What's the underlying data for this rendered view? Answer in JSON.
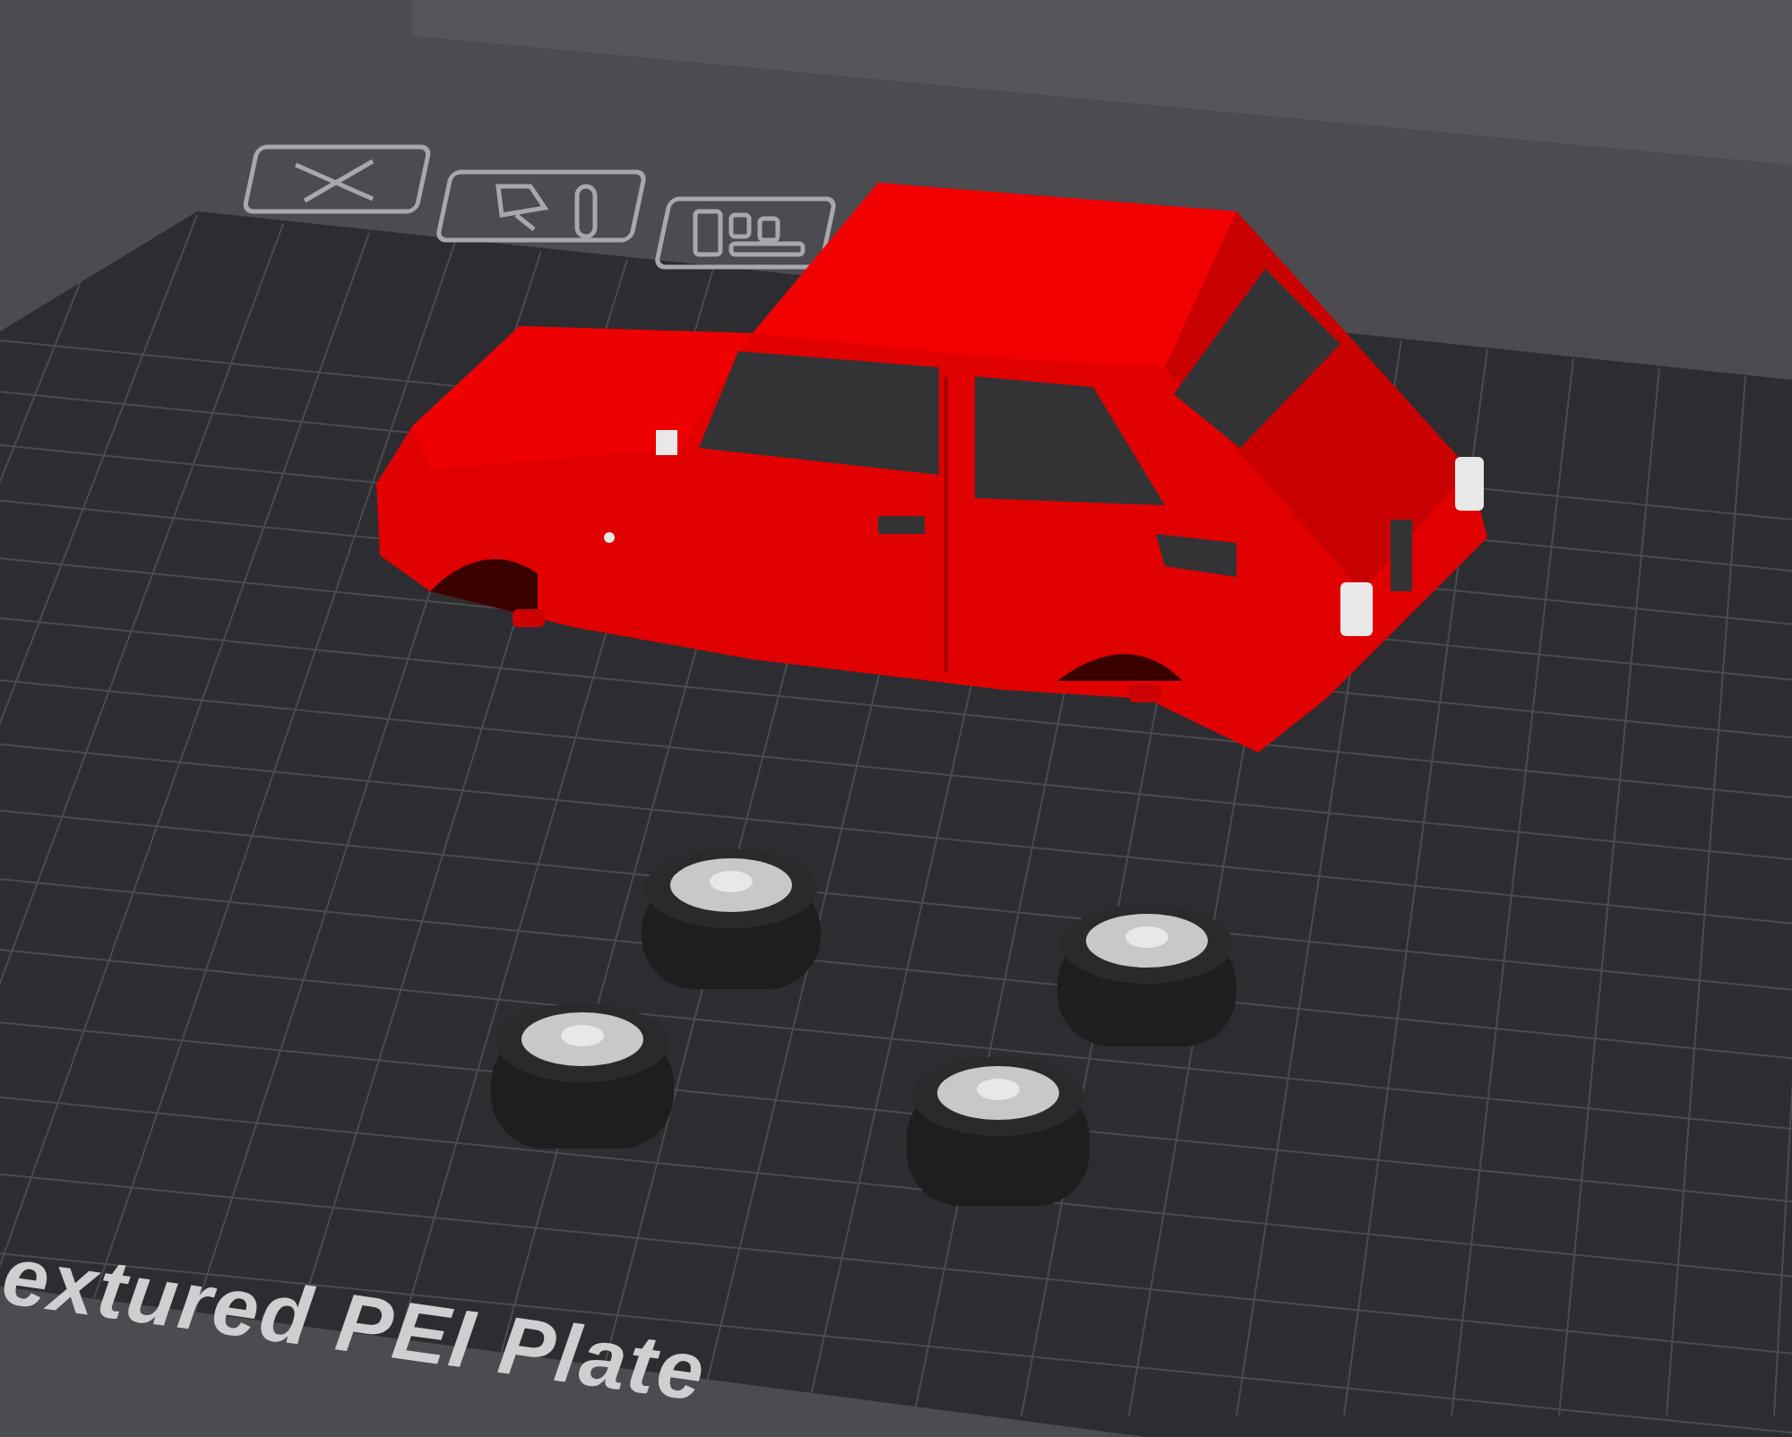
{
  "viewport": {
    "plate_label": "extured PEI Plate"
  }
}
